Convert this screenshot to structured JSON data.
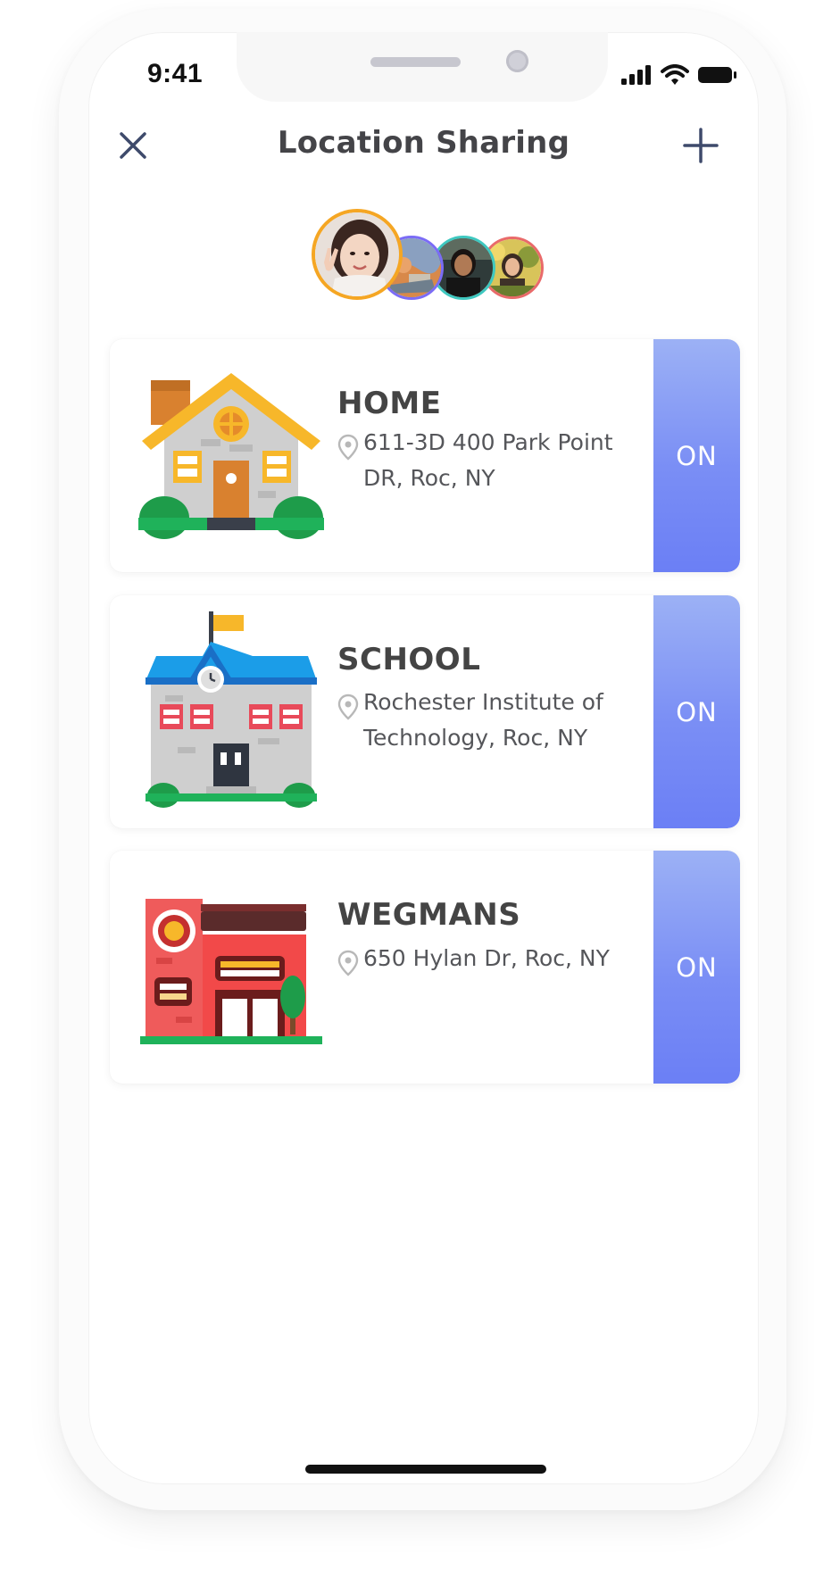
{
  "status_bar": {
    "time": "9:41"
  },
  "header": {
    "title": "Location Sharing",
    "close_icon": "close-icon",
    "add_icon": "plus-icon"
  },
  "avatars": [
    {
      "name": "avatar-1",
      "ring_color": "#f5a623"
    },
    {
      "name": "avatar-2",
      "ring_color": "#7b6cf6"
    },
    {
      "name": "avatar-3",
      "ring_color": "#3fc8c0"
    },
    {
      "name": "avatar-4",
      "ring_color": "#e96a6a"
    }
  ],
  "places": [
    {
      "name": "HOME",
      "address": "611-3D 400 Park Point DR, Roc, NY",
      "toggle_label": "ON",
      "icon": "house-icon"
    },
    {
      "name": "SCHOOL",
      "address": "Rochester Institute of Technology, Roc, NY",
      "toggle_label": "ON",
      "icon": "school-icon"
    },
    {
      "name": "WEGMANS",
      "address": "650 Hylan Dr, Roc, NY",
      "toggle_label": "ON",
      "icon": "store-icon"
    }
  ],
  "colors": {
    "toggle_on_top": "#9cb1f5",
    "toggle_on_bottom": "#6b7ff5",
    "title_text": "#444448",
    "icon_stroke": "#3e4a6b"
  }
}
